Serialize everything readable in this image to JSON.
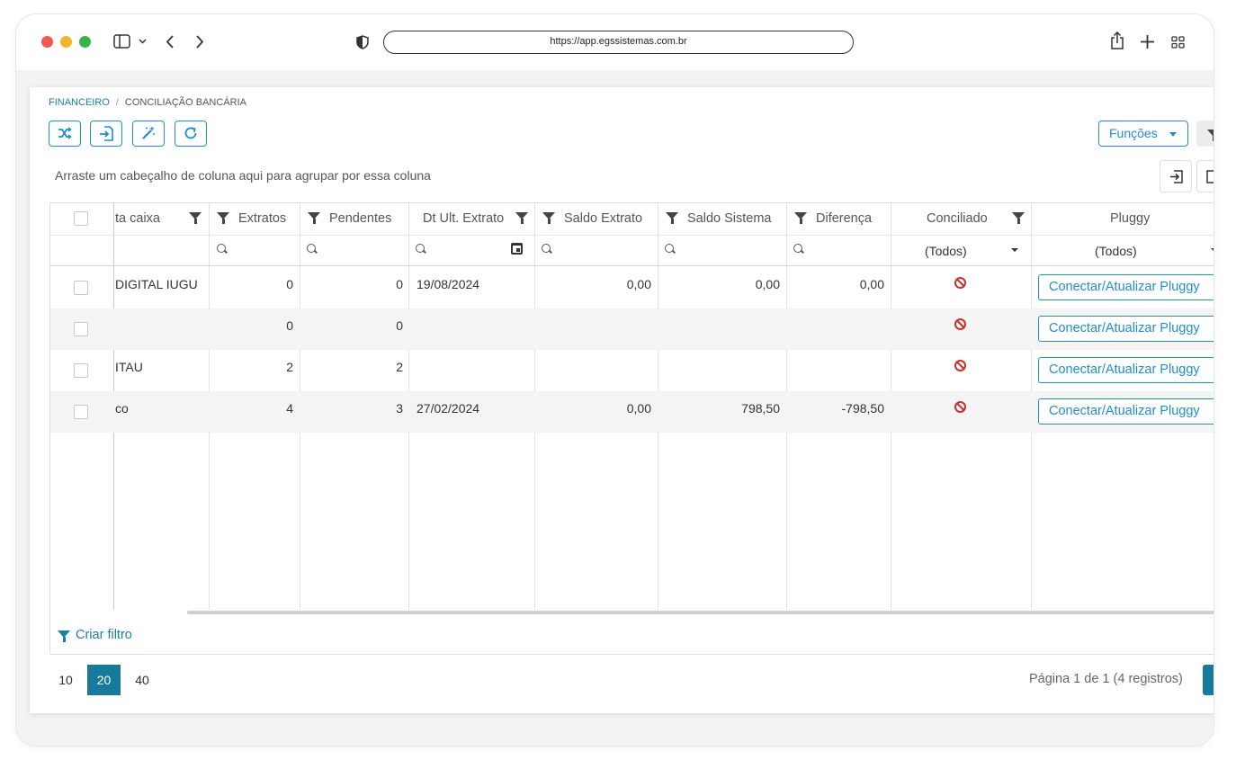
{
  "browser": {
    "url": "https://app.egssistemas.com.br"
  },
  "breadcrumb": {
    "root": "FINANCEIRO",
    "separator": "/",
    "current": "CONCILIAÇÃO BANCÁRIA"
  },
  "toolbar": {
    "functions_label": "Funções"
  },
  "grid": {
    "group_hint": "Arraste um cabeçalho de coluna aqui para agrupar por essa coluna",
    "headers": {
      "conta_caixa": "ta caixa",
      "extratos": "Extratos",
      "pendentes": "Pendentes",
      "dt_ult_extrato": "Dt Ult. Extrato",
      "saldo_extrato": "Saldo Extrato",
      "saldo_sistema": "Saldo Sistema",
      "diferenca": "Diferença",
      "conciliado": "Conciliado",
      "pluggy": "Pluggy"
    },
    "filters": {
      "conciliado": "(Todos)",
      "pluggy": "(Todos)"
    },
    "rows": [
      {
        "conta": "DIGITAL IUGU",
        "extratos": "0",
        "pendentes": "0",
        "dt": "19/08/2024",
        "saldo_extrato": "0,00",
        "saldo_sistema": "0,00",
        "diferenca": "0,00",
        "pluggy_label": "Conectar/Atualizar Pluggy"
      },
      {
        "conta": "",
        "extratos": "0",
        "pendentes": "0",
        "dt": "",
        "saldo_extrato": "",
        "saldo_sistema": "",
        "diferenca": "",
        "pluggy_label": "Conectar/Atualizar Pluggy"
      },
      {
        "conta": "ITAU",
        "extratos": "2",
        "pendentes": "2",
        "dt": "",
        "saldo_extrato": "",
        "saldo_sistema": "",
        "diferenca": "",
        "pluggy_label": "Conectar/Atualizar Pluggy"
      },
      {
        "conta": "co",
        "extratos": "4",
        "pendentes": "3",
        "dt": "27/02/2024",
        "saldo_extrato": "0,00",
        "saldo_sistema": "798,50",
        "diferenca": "-798,50",
        "pluggy_label": "Conectar/Atualizar Pluggy"
      }
    ],
    "create_filter": "Criar filtro"
  },
  "pager": {
    "sizes": [
      "10",
      "20",
      "40"
    ],
    "active_size": "20",
    "info": "Página 1 de 1 (4 registros)"
  },
  "colors": {
    "accent": "#1f8ed4",
    "pager_active": "#177a9c",
    "not_conciliated": "#c8312e"
  }
}
